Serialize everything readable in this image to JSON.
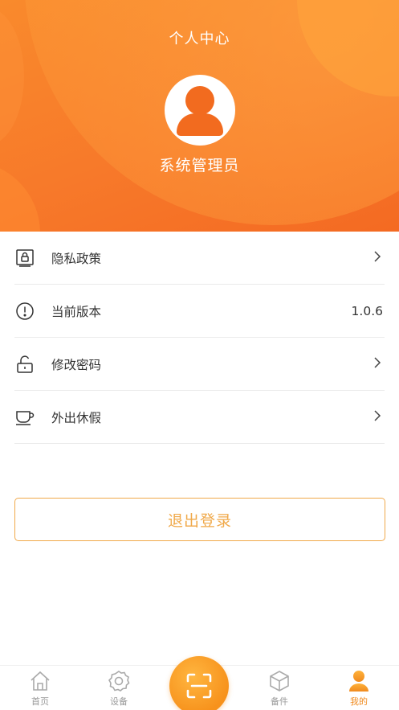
{
  "header": {
    "title": "个人中心",
    "user_name": "系统管理员"
  },
  "menu": {
    "items": [
      {
        "label": "隐私政策",
        "icon": "privacy-doc-icon"
      },
      {
        "label": "当前版本",
        "icon": "info-circle-icon",
        "value": "1.0.6"
      },
      {
        "label": "修改密码",
        "icon": "unlock-icon"
      },
      {
        "label": "外出休假",
        "icon": "coffee-cup-icon"
      }
    ]
  },
  "logout": {
    "label": "退出登录"
  },
  "tabbar": {
    "tabs": [
      {
        "label": "首页",
        "icon": "home-icon"
      },
      {
        "label": "设备",
        "icon": "gear-icon"
      },
      {
        "label": "备件",
        "icon": "box-icon"
      },
      {
        "label": "我的",
        "icon": "user-icon",
        "active": true
      }
    ],
    "scan_icon": "scan-icon"
  },
  "colors": {
    "brand_orange": "#f7792a",
    "accent_gold": "#f0a94a",
    "tab_active": "#f08a1e"
  }
}
